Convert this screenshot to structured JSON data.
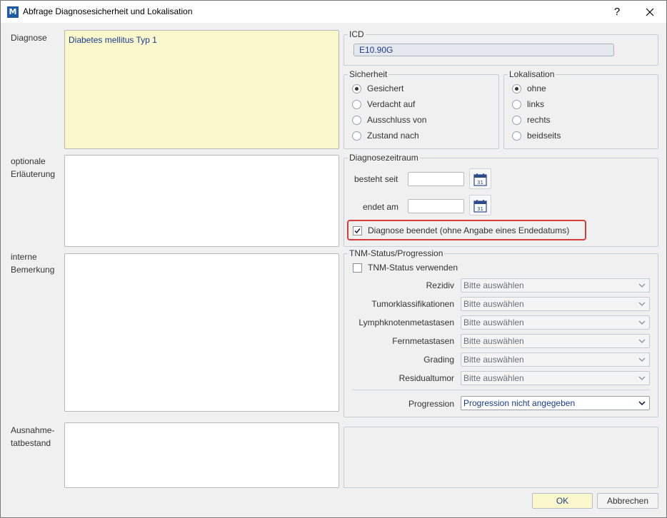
{
  "window": {
    "title": "Abfrage Diagnosesicherheit und Lokalisation",
    "icon": "mt-app-icon",
    "help_label": "?",
    "close_label": "✕"
  },
  "left": {
    "diagnose_label": "Diagnose",
    "diagnose_value": "Diabetes mellitus Typ 1",
    "erlaeuterung_label_1": "optionale",
    "erlaeuterung_label_2": "Erläuterung",
    "bemerkung_label_1": "interne",
    "bemerkung_label_2": "Bemerkung",
    "ausnahme_label_1": "Ausnahme-",
    "ausnahme_label_2": "tatbestand"
  },
  "icd": {
    "legend": "ICD",
    "value": "E10.90G"
  },
  "sicherheit": {
    "legend": "Sicherheit",
    "options": [
      "Gesichert",
      "Verdacht auf",
      "Ausschluss von",
      "Zustand nach"
    ],
    "selected_index": 0
  },
  "lokalisation": {
    "legend": "Lokalisation",
    "options": [
      "ohne",
      "links",
      "rechts",
      "beidseits"
    ],
    "selected_index": 0
  },
  "zeitraum": {
    "legend": "Diagnosezeitraum",
    "besteht_label": "besteht seit",
    "endet_label": "endet am",
    "besteht_value": "",
    "endet_value": "",
    "calendar_icon_text": "31",
    "beendet_label": "Diagnose beendet (ohne Angabe eines Endedatums)",
    "beendet_checked": true
  },
  "tnm": {
    "legend": "TNM-Status/Progression",
    "use_label": "TNM-Status verwenden",
    "use_checked": false,
    "rows": [
      {
        "label": "Rezidiv",
        "value": "Bitte auswählen"
      },
      {
        "label": "Tumorklassifikationen",
        "value": "Bitte auswählen"
      },
      {
        "label": "Lymphknotenmetastasen",
        "value": "Bitte auswählen"
      },
      {
        "label": "Fernmetastasen",
        "value": "Bitte auswählen"
      },
      {
        "label": "Grading",
        "value": "Bitte auswählen"
      },
      {
        "label": "Residualtumor",
        "value": "Bitte auswählen"
      }
    ],
    "progression_label": "Progression",
    "progression_value": "Progression nicht angegeben"
  },
  "buttons": {
    "ok": "OK",
    "cancel": "Abbrechen"
  },
  "colors": {
    "highlight": "#d93a3a",
    "diagnose_bg": "#fbf7cc",
    "value_text": "#1a3c8e"
  }
}
